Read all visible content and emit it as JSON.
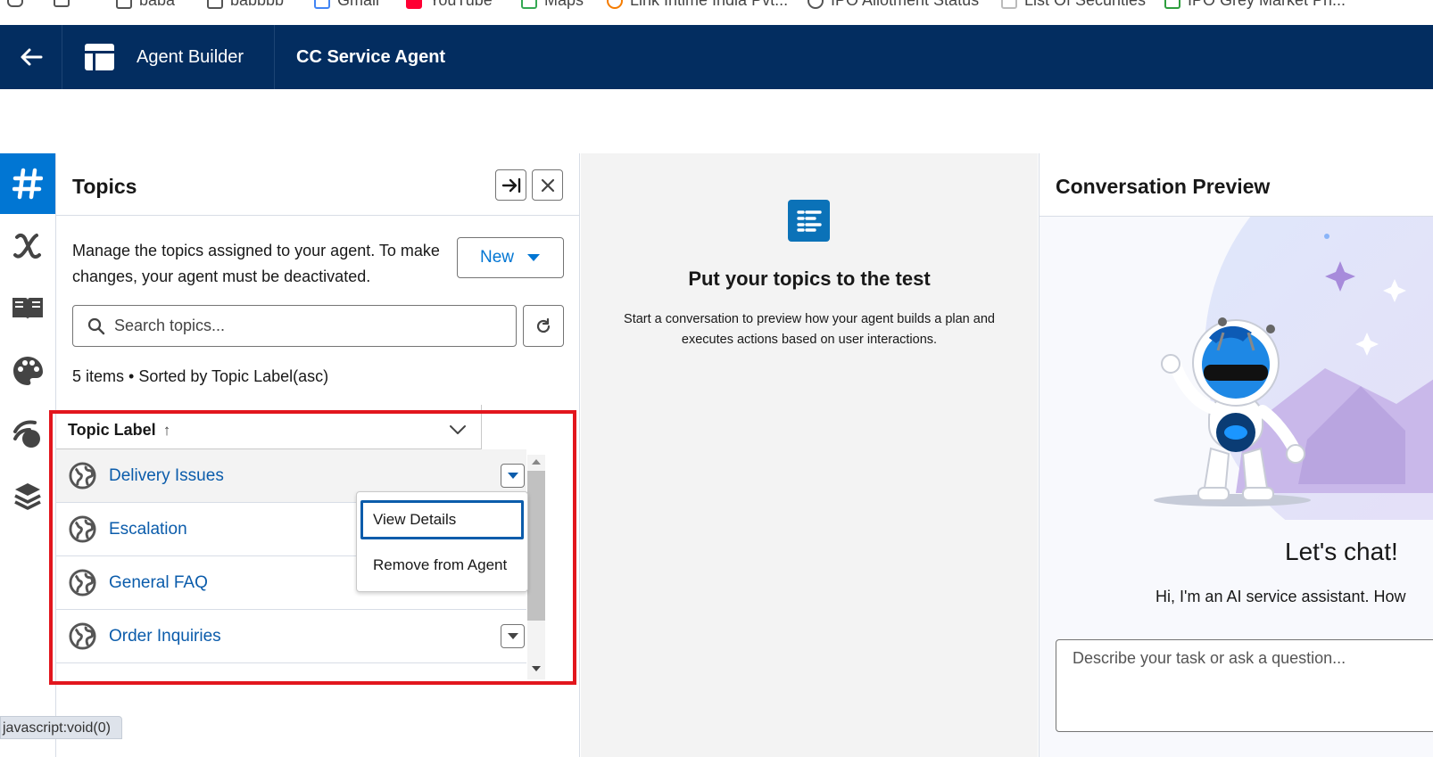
{
  "bookmarks": [
    {
      "label": "baba",
      "icon": "folder-icon"
    },
    {
      "label": "babbbb",
      "icon": "folder-icon"
    },
    {
      "label": "Gmail",
      "icon": "gmail-icon"
    },
    {
      "label": "YouTube",
      "icon": "youtube-icon"
    },
    {
      "label": "Maps",
      "icon": "maps-icon"
    },
    {
      "label": "Link Intime India Pvt...",
      "icon": "link-icon"
    },
    {
      "label": "IPO Allotment Status",
      "icon": "globe-icon"
    },
    {
      "label": "List Of Securities",
      "icon": "document-icon"
    },
    {
      "label": "IPO Grey Market Pri...",
      "icon": "chart-icon"
    }
  ],
  "header": {
    "app_title": "Agent Builder",
    "agent_name": "CC Service Agent"
  },
  "rail": [
    "topics-icon",
    "variables-icon",
    "library-icon",
    "palette-icon",
    "connections-icon",
    "layers-icon"
  ],
  "topics": {
    "title": "Topics",
    "description": "Manage the topics assigned to your agent. To make changes, your agent must be deactivated.",
    "new_label": "New",
    "search_placeholder": "Search topics...",
    "items_meta": "5 items • Sorted by Topic Label(asc)",
    "column_header": "Topic Label",
    "sort_indicator": "↑",
    "rows": [
      {
        "label": "Delivery Issues"
      },
      {
        "label": "Escalation"
      },
      {
        "label": "General FAQ"
      },
      {
        "label": "Order Inquiries"
      }
    ]
  },
  "row_menu": {
    "view_details": "View Details",
    "remove": "Remove from Agent"
  },
  "middle": {
    "title": "Put your topics to the test",
    "description": "Start a conversation to preview how your agent builds a plan and executes actions based on user interactions."
  },
  "conversation": {
    "title": "Conversation Preview",
    "chat_title": "Let's chat!",
    "chat_subtitle": "Hi, I'm an AI service assistant. How",
    "input_placeholder": "Describe your task or ask a question..."
  },
  "status_url": "javascript:void(0)",
  "colors": {
    "header_bg": "#032d60",
    "brand_blue": "#0176d3",
    "link_blue": "#0b5cab",
    "highlight_red": "#e2161d"
  }
}
